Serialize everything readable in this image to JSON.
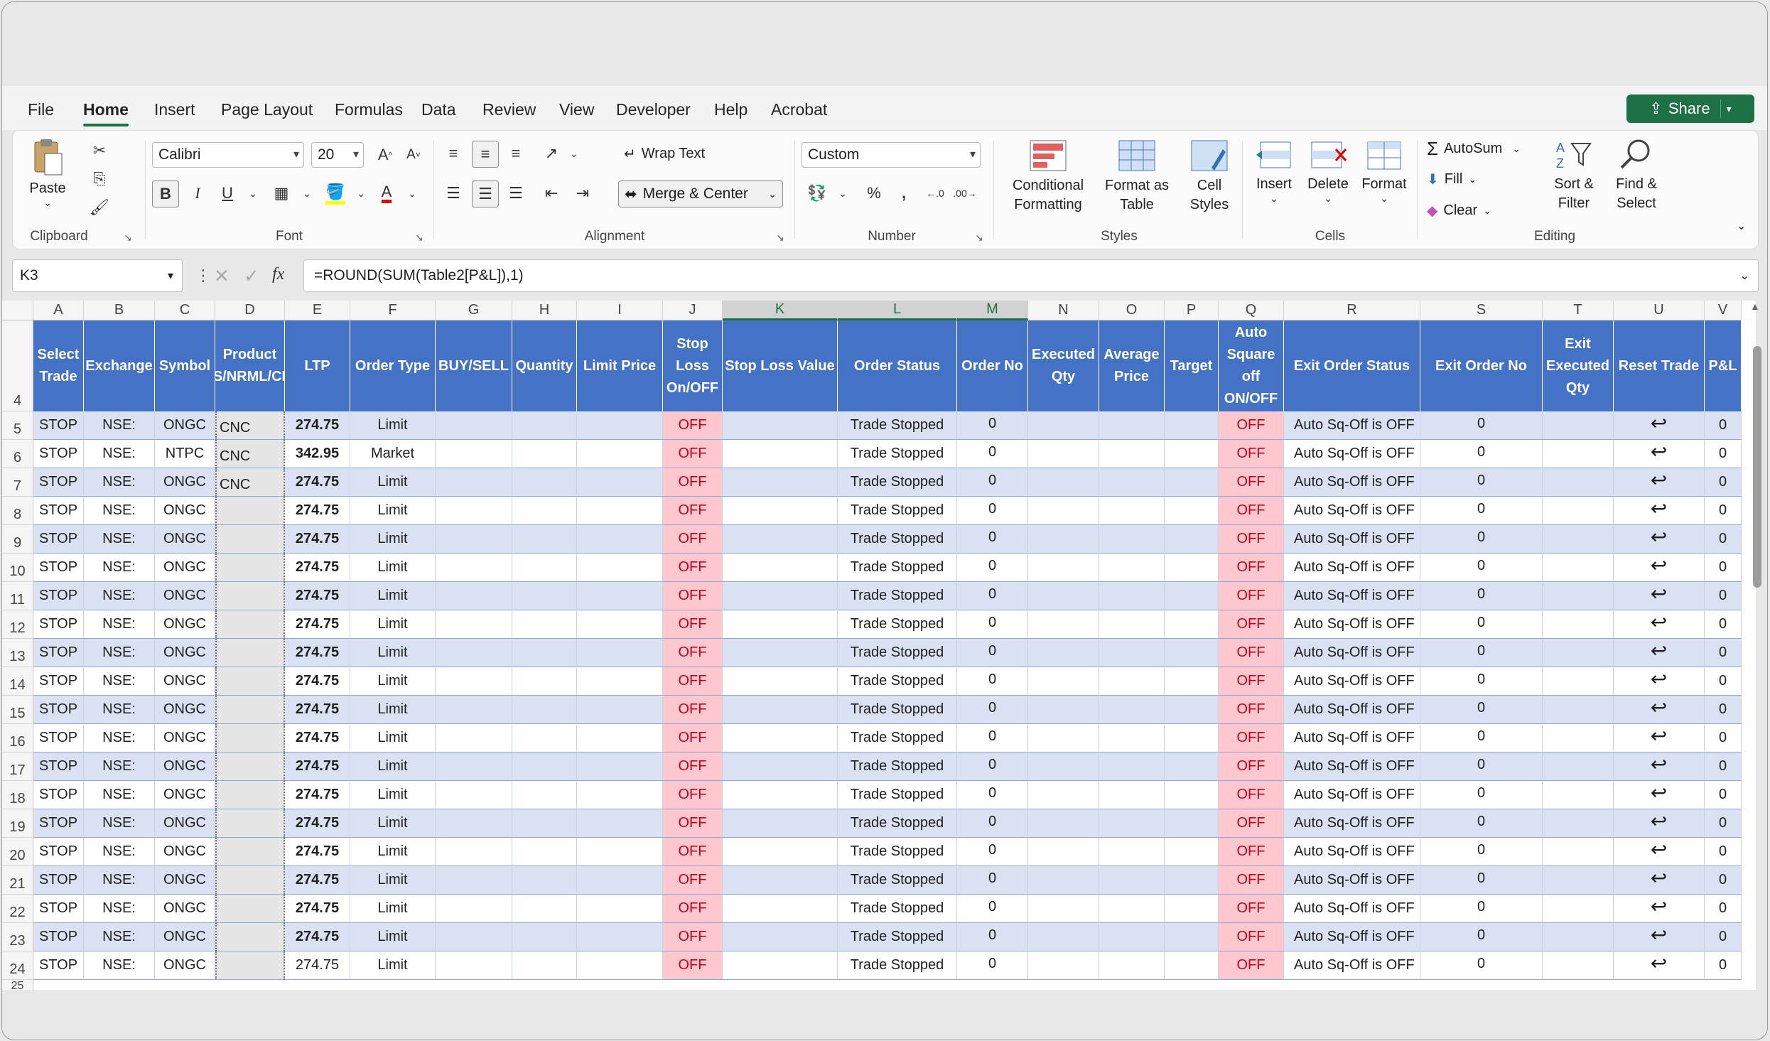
{
  "menu": {
    "tabs": [
      "File",
      "Home",
      "Insert",
      "Page Layout",
      "Formulas",
      "Data",
      "Review",
      "View",
      "Developer",
      "Help",
      "Acrobat"
    ],
    "active": "Home",
    "share_label": "Share"
  },
  "ribbon": {
    "clipboard": {
      "paste": "Paste",
      "label": "Clipboard"
    },
    "font": {
      "name": "Calibri",
      "size": "20",
      "label": "Font",
      "bold": "B",
      "italic": "I",
      "underline": "U"
    },
    "alignment": {
      "wrap_text": "Wrap Text",
      "merge_center": "Merge & Center",
      "label": "Alignment"
    },
    "number": {
      "format": "Custom",
      "label": "Number"
    },
    "styles": {
      "conditional": "Conditional Formatting",
      "format_table": "Format as Table",
      "cell_styles": "Cell Styles",
      "label": "Styles"
    },
    "cells": {
      "insert": "Insert",
      "delete": "Delete",
      "format": "Format",
      "label": "Cells"
    },
    "editing": {
      "autosum": "AutoSum",
      "fill": "Fill",
      "clear": "Clear",
      "sort_filter": "Sort & Filter",
      "find_select": "Find & Select",
      "label": "Editing"
    }
  },
  "formula_bar": {
    "name_box": "K3",
    "formula": "=ROUND(SUM(Table2[P&L]),1)",
    "fx": "fx"
  },
  "columns": [
    "A",
    "B",
    "C",
    "D",
    "E",
    "F",
    "G",
    "H",
    "I",
    "J",
    "K",
    "L",
    "M",
    "N",
    "O",
    "P",
    "Q",
    "R",
    "S",
    "T",
    "U",
    "V"
  ],
  "selected_columns": [
    "K",
    "L",
    "M"
  ],
  "header_row_number": "4",
  "table_headers": [
    "Select Trade",
    "Exchange",
    "Symbol",
    "Product (MIS/NRML/CNC)",
    "LTP",
    "Order Type",
    "BUY/SELL",
    "Quantity",
    "Limit Price",
    "Stop Loss On/OFF",
    "Stop Loss Value",
    "Order Status",
    "Order No",
    "Executed Qty",
    "Average Price",
    "Target",
    "Auto Square off ON/OFF",
    "Exit Order Status",
    "Exit Order No",
    "Exit Executed Qty",
    "Reset Trade",
    "P&L"
  ],
  "rows": [
    {
      "n": "5",
      "select": "STOP",
      "exchange": "NSE:",
      "symbol": "ONGC",
      "product": "CNC",
      "ltp": "274.75",
      "ltp_bold": true,
      "order_type": "Limit",
      "sl": "OFF",
      "status": "Trade Stopped",
      "order_no": "0",
      "auto_sq": "OFF",
      "exit_status": "Auto Sq-Off is OFF",
      "exit_no": "0",
      "pnl": "0"
    },
    {
      "n": "6",
      "select": "STOP",
      "exchange": "NSE:",
      "symbol": "NTPC",
      "product": "CNC",
      "ltp": "342.95",
      "ltp_bold": true,
      "order_type": "Market",
      "sl": "OFF",
      "status": "Trade Stopped",
      "order_no": "0",
      "auto_sq": "OFF",
      "exit_status": "Auto Sq-Off is OFF",
      "exit_no": "0",
      "pnl": "0"
    },
    {
      "n": "7",
      "select": "STOP",
      "exchange": "NSE:",
      "symbol": "ONGC",
      "product": "CNC",
      "ltp": "274.75",
      "ltp_bold": true,
      "order_type": "Limit",
      "sl": "OFF",
      "status": "Trade Stopped",
      "order_no": "0",
      "auto_sq": "OFF",
      "exit_status": "Auto Sq-Off is OFF",
      "exit_no": "0",
      "pnl": "0"
    },
    {
      "n": "8",
      "select": "STOP",
      "exchange": "NSE:",
      "symbol": "ONGC",
      "product": "",
      "ltp": "274.75",
      "ltp_bold": true,
      "order_type": "Limit",
      "sl": "OFF",
      "status": "Trade Stopped",
      "order_no": "0",
      "auto_sq": "OFF",
      "exit_status": "Auto Sq-Off is OFF",
      "exit_no": "0",
      "pnl": "0"
    },
    {
      "n": "9",
      "select": "STOP",
      "exchange": "NSE:",
      "symbol": "ONGC",
      "product": "",
      "ltp": "274.75",
      "ltp_bold": true,
      "order_type": "Limit",
      "sl": "OFF",
      "status": "Trade Stopped",
      "order_no": "0",
      "auto_sq": "OFF",
      "exit_status": "Auto Sq-Off is OFF",
      "exit_no": "0",
      "pnl": "0"
    },
    {
      "n": "10",
      "select": "STOP",
      "exchange": "NSE:",
      "symbol": "ONGC",
      "product": "",
      "ltp": "274.75",
      "ltp_bold": true,
      "order_type": "Limit",
      "sl": "OFF",
      "status": "Trade Stopped",
      "order_no": "0",
      "auto_sq": "OFF",
      "exit_status": "Auto Sq-Off is OFF",
      "exit_no": "0",
      "pnl": "0"
    },
    {
      "n": "11",
      "select": "STOP",
      "exchange": "NSE:",
      "symbol": "ONGC",
      "product": "",
      "ltp": "274.75",
      "ltp_bold": true,
      "order_type": "Limit",
      "sl": "OFF",
      "status": "Trade Stopped",
      "order_no": "0",
      "auto_sq": "OFF",
      "exit_status": "Auto Sq-Off is OFF",
      "exit_no": "0",
      "pnl": "0"
    },
    {
      "n": "12",
      "select": "STOP",
      "exchange": "NSE:",
      "symbol": "ONGC",
      "product": "",
      "ltp": "274.75",
      "ltp_bold": true,
      "order_type": "Limit",
      "sl": "OFF",
      "status": "Trade Stopped",
      "order_no": "0",
      "auto_sq": "OFF",
      "exit_status": "Auto Sq-Off is OFF",
      "exit_no": "0",
      "pnl": "0"
    },
    {
      "n": "13",
      "select": "STOP",
      "exchange": "NSE:",
      "symbol": "ONGC",
      "product": "",
      "ltp": "274.75",
      "ltp_bold": true,
      "order_type": "Limit",
      "sl": "OFF",
      "status": "Trade Stopped",
      "order_no": "0",
      "auto_sq": "OFF",
      "exit_status": "Auto Sq-Off is OFF",
      "exit_no": "0",
      "pnl": "0"
    },
    {
      "n": "14",
      "select": "STOP",
      "exchange": "NSE:",
      "symbol": "ONGC",
      "product": "",
      "ltp": "274.75",
      "ltp_bold": true,
      "order_type": "Limit",
      "sl": "OFF",
      "status": "Trade Stopped",
      "order_no": "0",
      "auto_sq": "OFF",
      "exit_status": "Auto Sq-Off is OFF",
      "exit_no": "0",
      "pnl": "0"
    },
    {
      "n": "15",
      "select": "STOP",
      "exchange": "NSE:",
      "symbol": "ONGC",
      "product": "",
      "ltp": "274.75",
      "ltp_bold": true,
      "order_type": "Limit",
      "sl": "OFF",
      "status": "Trade Stopped",
      "order_no": "0",
      "auto_sq": "OFF",
      "exit_status": "Auto Sq-Off is OFF",
      "exit_no": "0",
      "pnl": "0"
    },
    {
      "n": "16",
      "select": "STOP",
      "exchange": "NSE:",
      "symbol": "ONGC",
      "product": "",
      "ltp": "274.75",
      "ltp_bold": true,
      "order_type": "Limit",
      "sl": "OFF",
      "status": "Trade Stopped",
      "order_no": "0",
      "auto_sq": "OFF",
      "exit_status": "Auto Sq-Off is OFF",
      "exit_no": "0",
      "pnl": "0"
    },
    {
      "n": "17",
      "select": "STOP",
      "exchange": "NSE:",
      "symbol": "ONGC",
      "product": "",
      "ltp": "274.75",
      "ltp_bold": true,
      "order_type": "Limit",
      "sl": "OFF",
      "status": "Trade Stopped",
      "order_no": "0",
      "auto_sq": "OFF",
      "exit_status": "Auto Sq-Off is OFF",
      "exit_no": "0",
      "pnl": "0"
    },
    {
      "n": "18",
      "select": "STOP",
      "exchange": "NSE:",
      "symbol": "ONGC",
      "product": "",
      "ltp": "274.75",
      "ltp_bold": true,
      "order_type": "Limit",
      "sl": "OFF",
      "status": "Trade Stopped",
      "order_no": "0",
      "auto_sq": "OFF",
      "exit_status": "Auto Sq-Off is OFF",
      "exit_no": "0",
      "pnl": "0"
    },
    {
      "n": "19",
      "select": "STOP",
      "exchange": "NSE:",
      "symbol": "ONGC",
      "product": "",
      "ltp": "274.75",
      "ltp_bold": true,
      "order_type": "Limit",
      "sl": "OFF",
      "status": "Trade Stopped",
      "order_no": "0",
      "auto_sq": "OFF",
      "exit_status": "Auto Sq-Off is OFF",
      "exit_no": "0",
      "pnl": "0"
    },
    {
      "n": "20",
      "select": "STOP",
      "exchange": "NSE:",
      "symbol": "ONGC",
      "product": "",
      "ltp": "274.75",
      "ltp_bold": true,
      "order_type": "Limit",
      "sl": "OFF",
      "status": "Trade Stopped",
      "order_no": "0",
      "auto_sq": "OFF",
      "exit_status": "Auto Sq-Off is OFF",
      "exit_no": "0",
      "pnl": "0"
    },
    {
      "n": "21",
      "select": "STOP",
      "exchange": "NSE:",
      "symbol": "ONGC",
      "product": "",
      "ltp": "274.75",
      "ltp_bold": true,
      "order_type": "Limit",
      "sl": "OFF",
      "status": "Trade Stopped",
      "order_no": "0",
      "auto_sq": "OFF",
      "exit_status": "Auto Sq-Off is OFF",
      "exit_no": "0",
      "pnl": "0"
    },
    {
      "n": "22",
      "select": "STOP",
      "exchange": "NSE:",
      "symbol": "ONGC",
      "product": "",
      "ltp": "274.75",
      "ltp_bold": true,
      "order_type": "Limit",
      "sl": "OFF",
      "status": "Trade Stopped",
      "order_no": "0",
      "auto_sq": "OFF",
      "exit_status": "Auto Sq-Off is OFF",
      "exit_no": "0",
      "pnl": "0"
    },
    {
      "n": "23",
      "select": "STOP",
      "exchange": "NSE:",
      "symbol": "ONGC",
      "product": "",
      "ltp": "274.75",
      "ltp_bold": true,
      "order_type": "Limit",
      "sl": "OFF",
      "status": "Trade Stopped",
      "order_no": "0",
      "auto_sq": "OFF",
      "exit_status": "Auto Sq-Off is OFF",
      "exit_no": "0",
      "pnl": "0"
    },
    {
      "n": "24",
      "select": "STOP",
      "exchange": "NSE:",
      "symbol": "ONGC",
      "product": "",
      "ltp": "274.75",
      "ltp_bold": false,
      "order_type": "Limit",
      "sl": "OFF",
      "status": "Trade Stopped",
      "order_no": "0",
      "auto_sq": "OFF",
      "exit_status": "Auto Sq-Off is OFF",
      "exit_no": "0",
      "pnl": "0"
    }
  ],
  "partial_row_number": "25",
  "colors": {
    "header_blue": "#4472c4",
    "band": "#d9e1f2",
    "off_bg": "#ffc7ce",
    "off_text": "#c0001a",
    "accent": "#1e7145"
  },
  "icons": {
    "reset": "undo-arrow-icon"
  }
}
